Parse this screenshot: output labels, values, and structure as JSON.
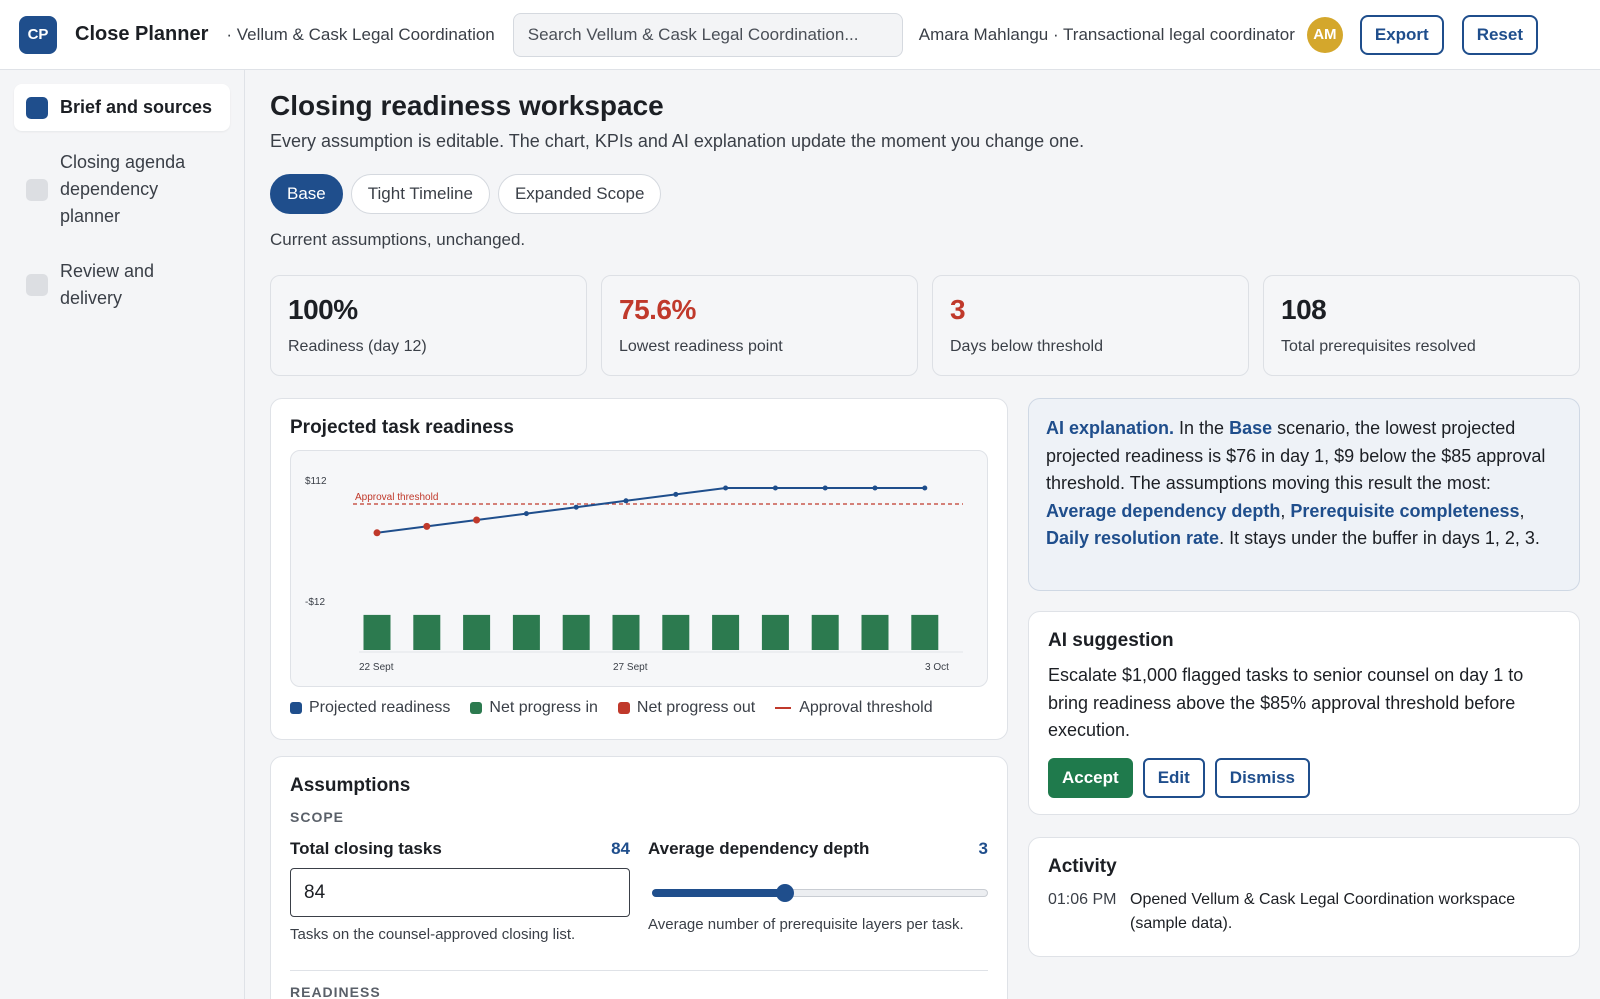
{
  "header": {
    "logo": "CP",
    "app_title": "Close Planner",
    "org_name": "· Vellum & Cask Legal Coordination",
    "search_placeholder": "Search Vellum & Cask Legal Coordination...",
    "user": "Amara Mahlangu · Transactional legal coordinator",
    "avatar_initials": "AM",
    "export_label": "Export",
    "reset_label": "Reset"
  },
  "sidebar": {
    "items": [
      {
        "label": "Brief and sources",
        "active": true
      },
      {
        "label": "Closing agenda dependency planner",
        "active": false
      },
      {
        "label": "Review and delivery",
        "active": false
      }
    ]
  },
  "main": {
    "title": "Closing readiness workspace",
    "subtitle": "Every assumption is editable. The chart, KPIs and AI explanation update the moment you change one.",
    "tabs": [
      "Base",
      "Tight Timeline",
      "Expanded Scope"
    ],
    "active_tab": "Base",
    "scenario_note": "Current assumptions, unchanged."
  },
  "kpis": [
    {
      "value": "100%",
      "label": "Readiness (day 12)",
      "color": "#1c1f24"
    },
    {
      "value": "75.6%",
      "label": "Lowest readiness point",
      "color": "#c0392b"
    },
    {
      "value": "3",
      "label": "Days below threshold",
      "color": "#c0392b"
    },
    {
      "value": "108",
      "label": "Total prerequisites resolved",
      "color": "#1c1f24"
    }
  ],
  "chart_card": {
    "title": "Projected task readiness",
    "legend": [
      "Projected readiness",
      "Net progress in",
      "Net progress out",
      "Approval threshold"
    ]
  },
  "chart_data": {
    "type": "line",
    "x_ticks": [
      "22 Sept",
      "27 Sept",
      "3 Oct"
    ],
    "y_ticks": [
      "$112",
      "-$12"
    ],
    "threshold_label": "Approval threshold",
    "threshold": 85,
    "series": [
      {
        "name": "Projected readiness",
        "color": "#1f4e8c",
        "values": [
          76,
          78,
          80,
          82,
          84,
          86,
          88,
          90,
          90,
          90,
          90,
          90
        ]
      },
      {
        "name": "Net progress in",
        "color": "#1f7a4c",
        "values": [
          9,
          9,
          9,
          9,
          9,
          9,
          9,
          9,
          9,
          9,
          9,
          9
        ]
      }
    ],
    "below_threshold_days": [
      1,
      2,
      3
    ],
    "colors": {
      "line": "#1f4e8c",
      "bar": "#2c7a4f",
      "out": "#c0392b",
      "threshold": "#c0392b"
    }
  },
  "assumptions": {
    "title": "Assumptions",
    "section_scope": "SCOPE",
    "section_readiness": "READINESS",
    "total_tasks": {
      "label": "Total closing tasks",
      "value": "84",
      "input": "84",
      "help": "Tasks on the counsel-approved closing list."
    },
    "avg_depth": {
      "label": "Average dependency depth",
      "value": "3",
      "help": "Average number of prerequisite layers per task.",
      "fraction": 0.4
    }
  },
  "ai_explanation": {
    "lead": "AI explanation.",
    "t1": " In the ",
    "scenario": "Base",
    "t2": " scenario, the lowest projected projected readiness is $76 in day 1, $9 below the $85 approval threshold. The assumptions moving this result the most: ",
    "f1": "Average dependency depth",
    "sep1": ", ",
    "f2": "Prerequisite completeness",
    "sep2": ", ",
    "f3": "Daily resolution rate",
    "t3": ". It stays under the buffer in days 1, 2, 3."
  },
  "ai_suggestion": {
    "title": "AI suggestion",
    "text": "Escalate $1,000 flagged tasks to senior counsel on day 1 to bring readiness above the $85% approval threshold before execution.",
    "accept": "Accept",
    "edit": "Edit",
    "dismiss": "Dismiss"
  },
  "activity": {
    "title": "Activity",
    "entries": [
      {
        "time": "01:06 PM",
        "text": "Opened Vellum & Cask Legal Coordination workspace (sample data)."
      }
    ]
  }
}
